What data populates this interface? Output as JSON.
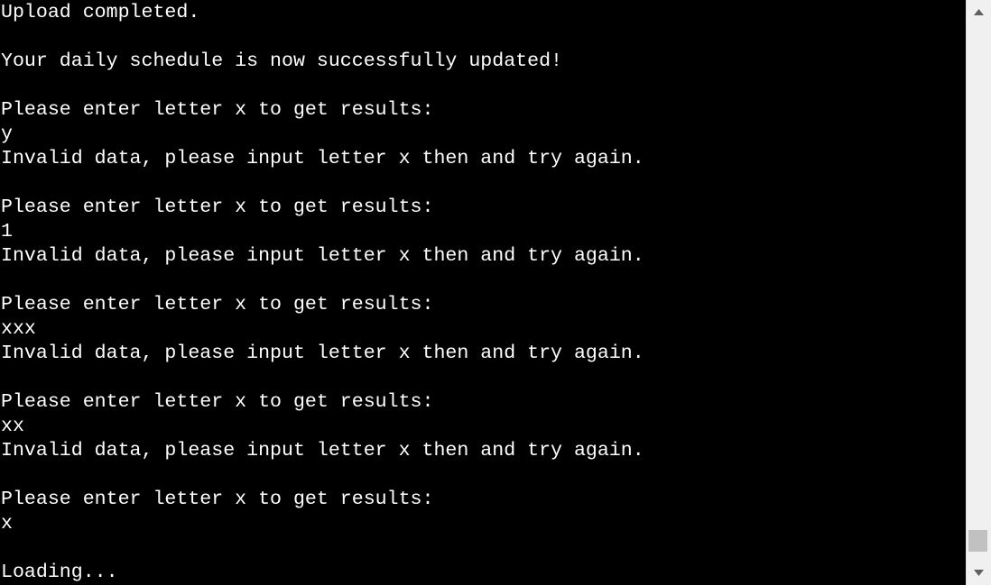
{
  "terminal": {
    "lines": [
      "Upload completed.",
      "",
      "Your daily schedule is now successfully updated!",
      "",
      "Please enter letter x to get results:",
      "y",
      "Invalid data, please input letter x then and try again.",
      "",
      "Please enter letter x to get results:",
      "1",
      "Invalid data, please input letter x then and try again.",
      "",
      "Please enter letter x to get results:",
      "xxx",
      "Invalid data, please input letter x then and try again.",
      "",
      "Please enter letter x to get results:",
      "xx",
      "Invalid data, please input letter x then and try again.",
      "",
      "Please enter letter x to get results:",
      "x",
      "",
      "Loading..."
    ]
  },
  "scrollbar": {
    "up_icon": "triangle-up-icon",
    "down_icon": "triangle-down-icon",
    "position_fraction": 0.95
  },
  "colors": {
    "background": "#000000",
    "text": "#ffffff",
    "scrollbar_track": "#f0f0f0",
    "scrollbar_thumb": "#c1c1c1",
    "scrollbar_arrow": "#606060"
  }
}
